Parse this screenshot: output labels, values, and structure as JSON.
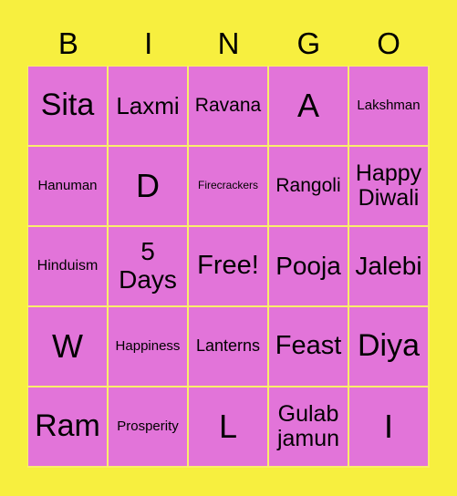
{
  "colors": {
    "background": "#f7ef3f",
    "cell": "#e274d9",
    "grid_line": "#f9ee6a",
    "text": "#000000"
  },
  "header": [
    "B",
    "I",
    "N",
    "G",
    "O"
  ],
  "cells": [
    {
      "text": "Sita",
      "size": 34
    },
    {
      "text": "Laxmi",
      "size": 26
    },
    {
      "text": "Ravana",
      "size": 21
    },
    {
      "text": "A",
      "size": 36
    },
    {
      "text": "Lakshman",
      "size": 15
    },
    {
      "text": "Hanuman",
      "size": 15
    },
    {
      "text": "D",
      "size": 36
    },
    {
      "text": "Firecrackers",
      "size": 12
    },
    {
      "text": "Rangoli",
      "size": 21
    },
    {
      "text": "Happy Diwali",
      "size": 25
    },
    {
      "text": "Hinduism",
      "size": 16
    },
    {
      "text": "5 Days",
      "size": 28
    },
    {
      "text": "Free!",
      "size": 29
    },
    {
      "text": "Pooja",
      "size": 28
    },
    {
      "text": "Jalebi",
      "size": 28
    },
    {
      "text": "W",
      "size": 36
    },
    {
      "text": "Happiness",
      "size": 15
    },
    {
      "text": "Lanterns",
      "size": 18
    },
    {
      "text": "Feast",
      "size": 29
    },
    {
      "text": "Diya",
      "size": 34
    },
    {
      "text": "Ram",
      "size": 34
    },
    {
      "text": "Prosperity",
      "size": 15
    },
    {
      "text": "L",
      "size": 36
    },
    {
      "text": "Gulab jamun",
      "size": 25
    },
    {
      "text": "I",
      "size": 36
    }
  ]
}
